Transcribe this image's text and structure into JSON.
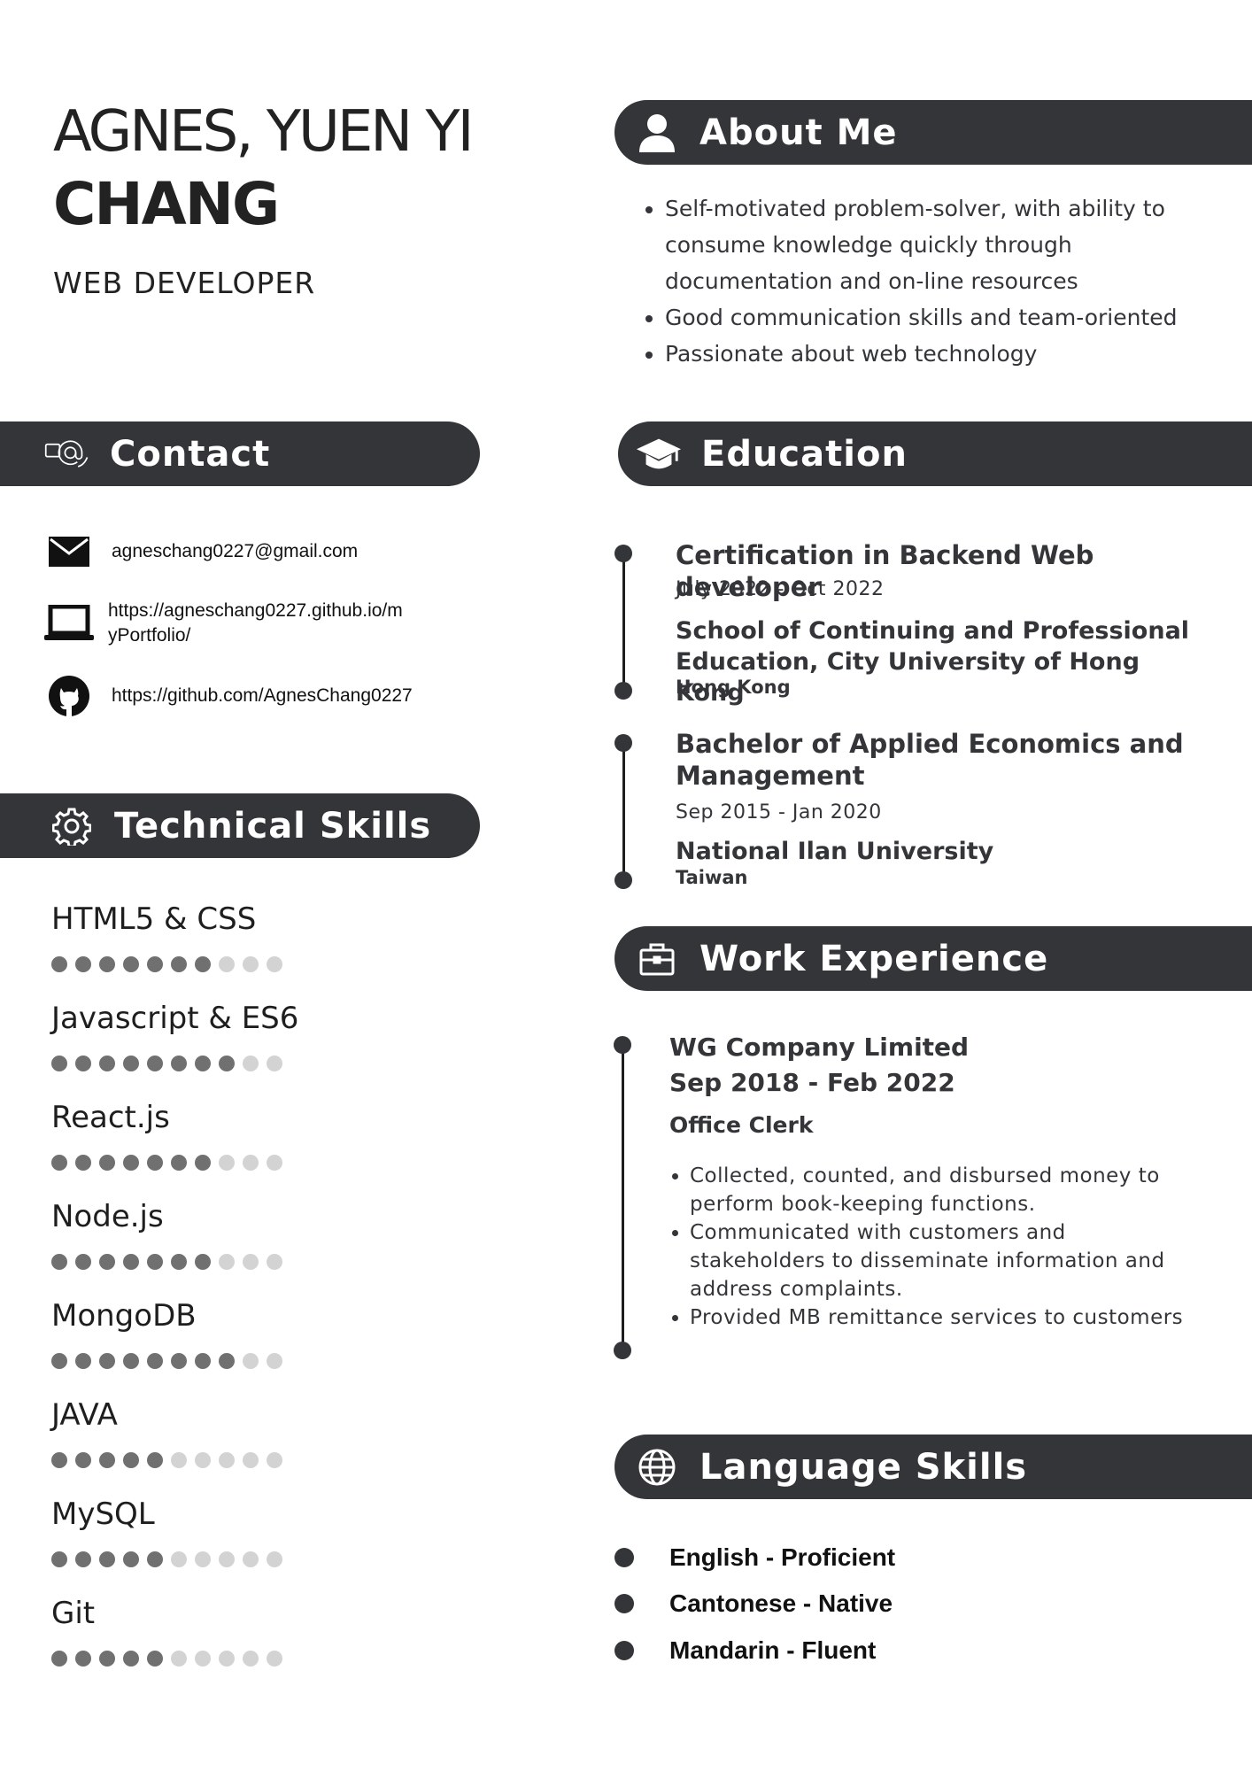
{
  "header": {
    "name_line1": "AGNES, YUEN YI",
    "name_line2": "CHANG",
    "job_title": "WEB DEVELOPER"
  },
  "about": {
    "title": "About Me",
    "icon": "person-icon",
    "items": [
      "Self-motivated problem-solver, with ability to consume knowledge quickly through documentation and on-line resources",
      "Good communication skills and team-oriented",
      "Passionate about web technology"
    ]
  },
  "contact": {
    "title": "Contact",
    "icon": "contact-at-icon",
    "email": "agneschang0227@gmail.com",
    "portfolio_line1": "https://agneschang0227.github.io/m",
    "portfolio_line2": "yPortfolio/",
    "github": "https://github.com/AgnesChang0227"
  },
  "skills": {
    "title": "Technical Skills",
    "icon": "gear-icon",
    "max": 10,
    "items": [
      {
        "name": "HTML5 & CSS",
        "level": 7
      },
      {
        "name": "Javascript & ES6",
        "level": 8
      },
      {
        "name": "React.js",
        "level": 7
      },
      {
        "name": "Node.js",
        "level": 7
      },
      {
        "name": "MongoDB",
        "level": 8
      },
      {
        "name": "JAVA",
        "level": 5
      },
      {
        "name": "MySQL",
        "level": 5
      },
      {
        "name": "Git",
        "level": 5
      }
    ]
  },
  "education": {
    "title": "Education",
    "icon": "graduation-cap-icon",
    "entries": [
      {
        "title": "Certification in Backend Web developer",
        "date": "July 2022 - Oct 2022",
        "school": "School of Continuing and Professional Education, City University of Hong Kong",
        "location": "Hong Kong"
      },
      {
        "title": "Bachelor of Applied Economics and Management",
        "date": "Sep 2015 - Jan 2020",
        "school": "National Ilan University",
        "location": "Taiwan"
      }
    ]
  },
  "work": {
    "title": "Work Experience",
    "icon": "briefcase-icon",
    "company": "WG Company Limited",
    "period": "Sep 2018 - Feb 2022",
    "role": "Office Clerk",
    "duties": [
      "Collected, counted, and disbursed money to perform book-keeping functions.",
      "Communicated with customers and stakeholders to disseminate information and address complaints.",
      "Provided MB remittance services to customers"
    ]
  },
  "languages": {
    "title": "Language Skills",
    "icon": "globe-icon",
    "items": [
      "English - Proficient",
      "Cantonese - Native",
      "Mandarin - Fluent"
    ]
  },
  "colors": {
    "bar": "#333539",
    "dot_filled": "#707070",
    "dot_empty": "#d3d3d3"
  }
}
